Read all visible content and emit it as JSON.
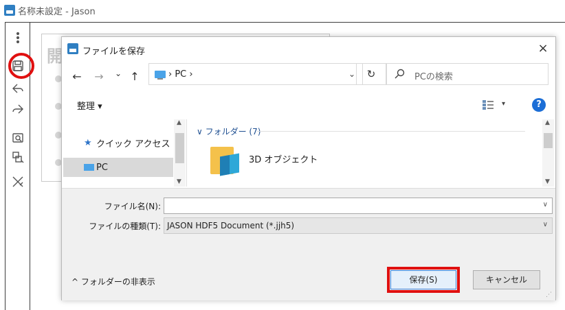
{
  "app": {
    "title": "名称未設定 - Jason",
    "background_heading": "開"
  },
  "dialog": {
    "title": "ファイルを保存",
    "close_label": "×",
    "nav": {
      "back": "←",
      "forward": "→",
      "recent": "⌄",
      "up": "↑"
    },
    "address": {
      "path_text": "› PC ›",
      "dropdown": "⌄",
      "refresh": "↻"
    },
    "search": {
      "placeholder": "PCの検索"
    },
    "commands": {
      "organize": "整理 ▾",
      "view_caret": "▾",
      "help": "?"
    },
    "nav_pane": {
      "items": [
        {
          "label": "クイック アクセス"
        },
        {
          "label": "PC"
        }
      ]
    },
    "content": {
      "group_header": "∨ フォルダー (7)",
      "folders": [
        {
          "name": "3D オブジェクト"
        }
      ]
    },
    "form": {
      "filename_label": "ファイル名(N):",
      "filename_value": "",
      "filetype_label": "ファイルの種類(T):",
      "filetype_value": "JASON HDF5 Document (*.jjh5)"
    },
    "footer": {
      "hide_folders": "^ フォルダーの非表示",
      "save_label": "保存(S)",
      "cancel_label": "キャンセル"
    }
  },
  "colors": {
    "highlight_red": "#e01010",
    "accent_blue": "#1c6ed6",
    "folder_yellow": "#f4c14b"
  }
}
